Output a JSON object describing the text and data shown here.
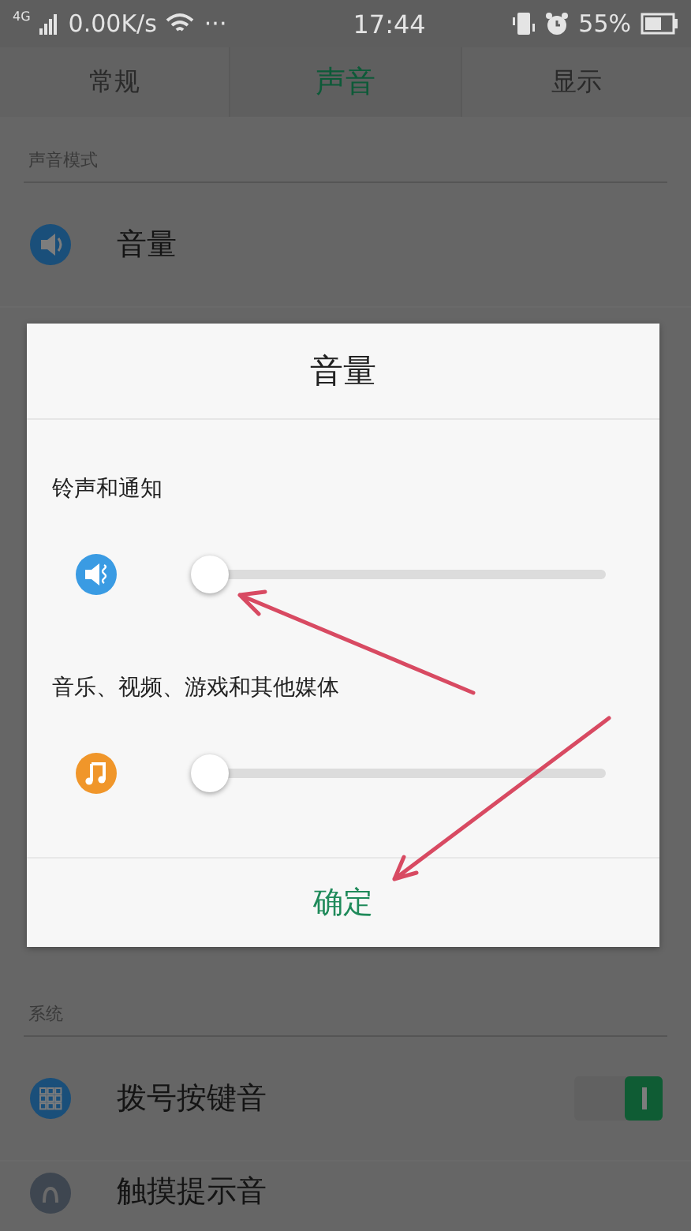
{
  "status_bar": {
    "network": "4G",
    "speed": "0.00K/s",
    "more": "···",
    "time": "17:44",
    "battery": "55%"
  },
  "tabs": [
    {
      "label": "常规",
      "selected": false
    },
    {
      "label": "声音",
      "selected": true
    },
    {
      "label": "显示",
      "selected": false
    }
  ],
  "sections": [
    {
      "title": "声音模式",
      "rows": [
        {
          "label": "音量",
          "kind": "speaker"
        }
      ]
    },
    {
      "title": "系统",
      "rows": [
        {
          "label": "拨号按键音",
          "kind": "dialpad",
          "on": true
        },
        {
          "label": "触摸提示音",
          "kind": "touch"
        }
      ]
    }
  ],
  "dialog": {
    "title": "音量",
    "sliders": [
      {
        "label": "铃声和通知",
        "kind": "ring",
        "level": 0
      },
      {
        "label": "音乐、视频、游戏和其他媒体",
        "kind": "music",
        "level": 0
      }
    ],
    "button": "确定"
  }
}
